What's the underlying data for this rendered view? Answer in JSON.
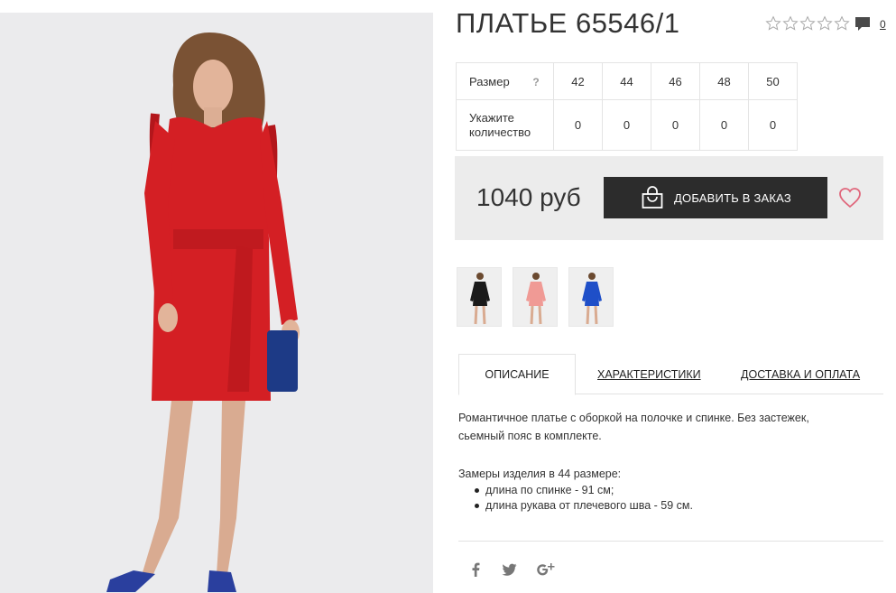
{
  "product": {
    "title": "ПЛАТЬЕ 65546/1",
    "rating_stars": 0,
    "rating_max": 5,
    "comment_count": "0"
  },
  "size_table": {
    "size_label": "Размер",
    "help_mark": "?",
    "quantity_label": "Укажите количество",
    "sizes": [
      "42",
      "44",
      "46",
      "48",
      "50"
    ],
    "quantities": [
      "0",
      "0",
      "0",
      "0",
      "0"
    ]
  },
  "purchase": {
    "price": "1040 руб",
    "add_to_order_label": "ДОБАВИТЬ В ЗАКАЗ"
  },
  "thumbnails": [
    {
      "color": "#1a1a1a",
      "name": "black-dress"
    },
    {
      "color": "#f09a95",
      "name": "pink-dress"
    },
    {
      "color": "#1f4fc8",
      "name": "blue-dress"
    }
  ],
  "tabs": [
    {
      "label": "ОПИСАНИЕ",
      "active": true
    },
    {
      "label": "ХАРАКТЕРИСТИКИ",
      "active": false
    },
    {
      "label": "ДОСТАВКА И ОПЛАТА",
      "active": false
    }
  ],
  "description": {
    "intro": "Романтичное платье с оборкой на полочке и спинке. Без застежек, сьемный пояс в комплекте.",
    "measurements_title": "Замеры изделия в 44 размере:",
    "measurements": [
      "длина по спинке - 91 см;",
      "длина рукава от плечевого шва - 59 см."
    ]
  },
  "social": [
    "facebook-icon",
    "twitter-icon",
    "google-plus-icon"
  ],
  "colors": {
    "dress_red": "#d41f24",
    "button_dark": "#2c2c2c",
    "heart_pink": "#e0677c",
    "price_bg": "#ececec",
    "photo_bg": "#ebebed"
  }
}
